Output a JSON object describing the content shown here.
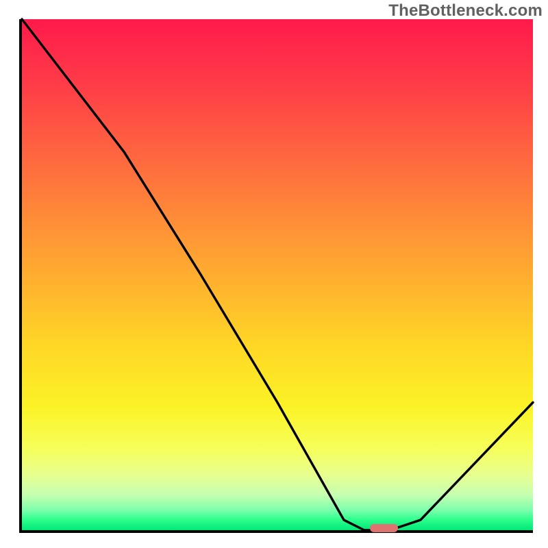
{
  "watermark": "TheBottleneck.com",
  "chart_data": {
    "type": "line",
    "title": "",
    "xlabel": "",
    "ylabel": "",
    "xlim": [
      0,
      100
    ],
    "ylim": [
      0,
      100
    ],
    "grid": false,
    "series": [
      {
        "name": "curve",
        "x": [
          0,
          20,
          35,
          50,
          63,
          67,
          72,
          78,
          100
        ],
        "y": [
          100,
          74,
          50,
          25,
          2,
          0,
          0,
          2,
          25
        ]
      }
    ],
    "marker": {
      "x_center": 70.5,
      "width_pct": 5.5,
      "height_pct": 1.6
    },
    "colors": {
      "gradient_top": "#ff1a4b",
      "gradient_bottom": "#00e676",
      "curve": "#000000",
      "marker": "#e0726f"
    }
  }
}
